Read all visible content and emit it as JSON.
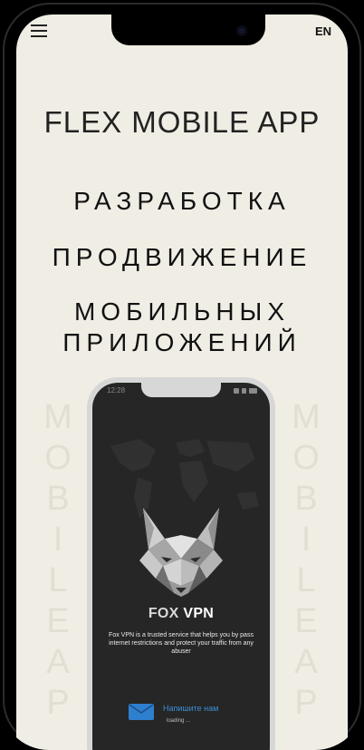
{
  "header": {
    "lang_label": "EN"
  },
  "main": {
    "app_title": "FLEX MOBILE APP",
    "headlines": [
      "РАЗРАБОТКА",
      "ПРОДВИЖЕНИЕ",
      "МОБИЛЬНЫХ",
      "ПРИЛОЖЕНИЙ"
    ],
    "side_word_left": [
      "M",
      "O",
      "B",
      "I",
      "L",
      "E",
      "A",
      "P"
    ],
    "side_word_right": [
      "M",
      "O",
      "B",
      "I",
      "L",
      "E",
      "A",
      "P"
    ]
  },
  "phone_mock": {
    "time": "12:28",
    "brand_part1": "FOX ",
    "brand_part2": "VPN",
    "description": "Fox VPN is a trusted service that helps you by pass internet restrictions and protect your traffic from any abuser",
    "contact_label": "Напишите нам",
    "loading_text": "loading ..."
  },
  "colors": {
    "background": "#f0ede4",
    "contact_accent": "#3d8ed7",
    "mock_screen": "#262626"
  }
}
